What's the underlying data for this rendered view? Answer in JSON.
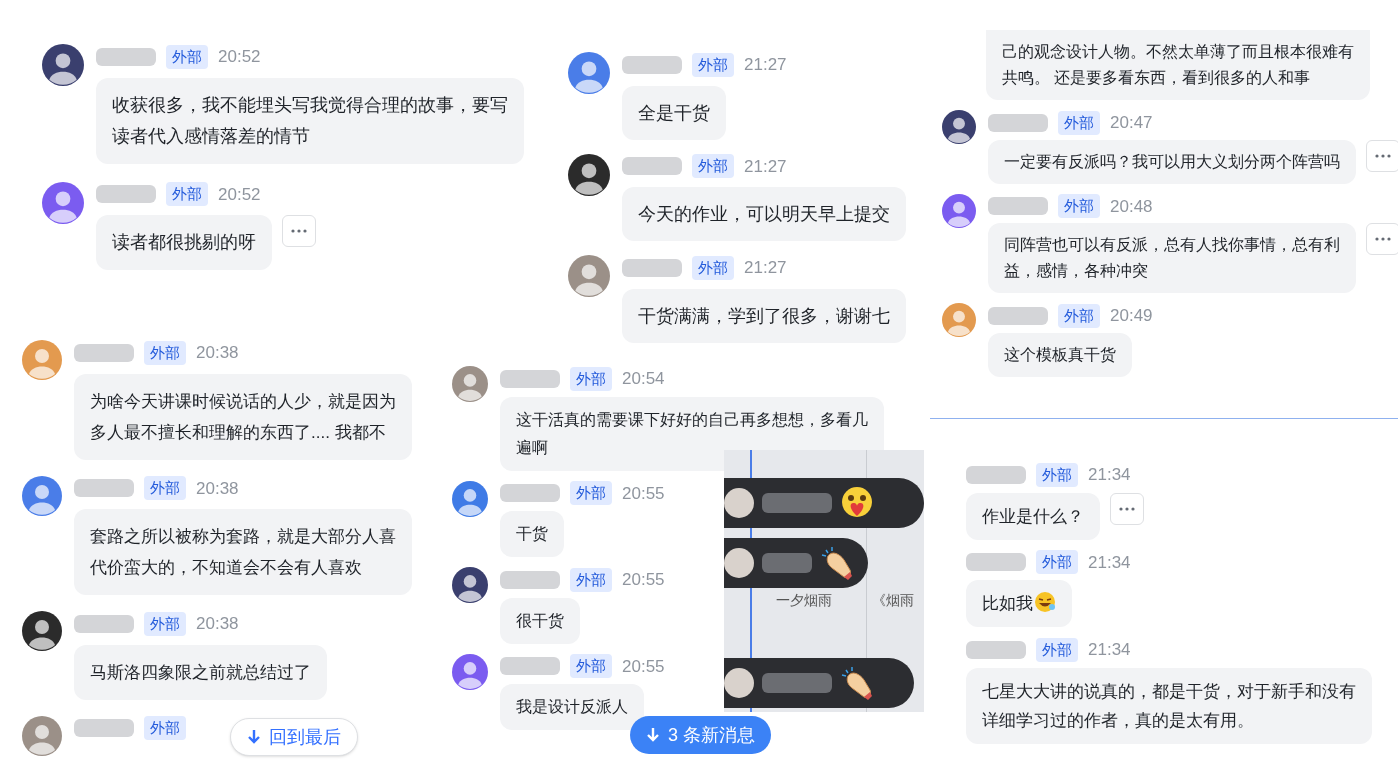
{
  "panels": [
    {
      "messages": [
        {
          "kind": "message",
          "badge": "外部",
          "time": "20:52",
          "lines": [
            "收获很多，我不能埋头写我觉得合理的故事，要写",
            "读者代入感情落差的情节"
          ],
          "more": false
        },
        {
          "kind": "message",
          "badge": "外部",
          "time": "20:52",
          "lines": [
            "读者都很挑剔的呀"
          ],
          "more": true
        }
      ]
    },
    {
      "messages": [
        {
          "kind": "message",
          "badge": "外部",
          "time": "21:27",
          "lines": [
            "全是干货"
          ],
          "more": false
        },
        {
          "kind": "message",
          "badge": "外部",
          "time": "21:27",
          "lines": [
            "今天的作业，可以明天早上提交"
          ],
          "more": false
        },
        {
          "kind": "message",
          "badge": "外部",
          "time": "21:27",
          "lines": [
            "干货满满，学到了很多，谢谢七"
          ],
          "more": false
        }
      ]
    },
    {
      "messages": [
        {
          "kind": "continued",
          "lines": [
            "己的观念设计人物。不然太单薄了而且根本很难有",
            "共鸣。 还是要多看东西，看到很多的人和事"
          ],
          "more": false
        },
        {
          "kind": "message",
          "badge": "外部",
          "time": "20:47",
          "lines": [
            "一定要有反派吗？我可以用大义划分两个阵营吗"
          ],
          "more": true
        },
        {
          "kind": "message",
          "badge": "外部",
          "time": "20:48",
          "lines": [
            "同阵营也可以有反派，总有人找你事情，总有利",
            "益，感情，各种冲突"
          ],
          "more": true
        },
        {
          "kind": "message",
          "badge": "外部",
          "time": "20:49",
          "lines": [
            "这个模板真干货"
          ],
          "more": false
        }
      ]
    },
    {
      "messages": [
        {
          "kind": "message",
          "badge": "外部",
          "time": "20:38",
          "lines": [
            "为啥今天讲课时候说话的人少，就是因为",
            "多人最不擅长和理解的东西了....  我都不"
          ],
          "more": false
        },
        {
          "kind": "message",
          "badge": "外部",
          "time": "20:38",
          "lines": [
            "套路之所以被称为套路，就是大部分人喜",
            "代价蛮大的，不知道会不会有人喜欢"
          ],
          "more": false
        },
        {
          "kind": "message",
          "badge": "外部",
          "time": "20:38",
          "lines": [
            "马斯洛四象限之前就总结过了"
          ],
          "more": false
        },
        {
          "kind": "header_only",
          "badge": "外部"
        }
      ],
      "jump_button": {
        "label": "回到最后"
      }
    },
    {
      "messages": [
        {
          "kind": "message",
          "badge": "外部",
          "time": "20:54",
          "lines": [
            "这干活真的需要课下好好的自己再多想想，多看几",
            "遍啊"
          ],
          "more": false
        },
        {
          "kind": "message",
          "badge": "外部",
          "time": "20:55",
          "lines": [
            "干货"
          ],
          "more": false
        },
        {
          "kind": "message",
          "badge": "外部",
          "time": "20:55",
          "lines": [
            "很干货"
          ],
          "more": false
        },
        {
          "kind": "message",
          "badge": "外部",
          "time": "20:55",
          "lines": [
            "我是设计反派人"
          ],
          "more": false
        }
      ],
      "new_messages_button": {
        "label": "3 条新消息"
      }
    },
    {
      "messages": [
        {
          "kind": "message",
          "badge": "外部",
          "time": "21:34",
          "lines": [
            "作业是什么？"
          ],
          "more": true
        },
        {
          "kind": "message",
          "badge": "外部",
          "time": "21:34",
          "lines": [
            "比如我"
          ],
          "more": false,
          "emoji": true
        },
        {
          "kind": "message",
          "badge": "外部",
          "time": "21:34",
          "lines": [
            "七星大大讲的说真的，都是干货，对于新手和没有",
            "详细学习过的作者，真的是太有用。"
          ],
          "more": false
        }
      ]
    }
  ],
  "live_overlay": {
    "comments": [
      {
        "kind": "heart"
      },
      {
        "kind": "clap"
      },
      {
        "kind": "clap"
      }
    ],
    "captions": [
      "一夕烟雨",
      "《烟雨"
    ]
  }
}
